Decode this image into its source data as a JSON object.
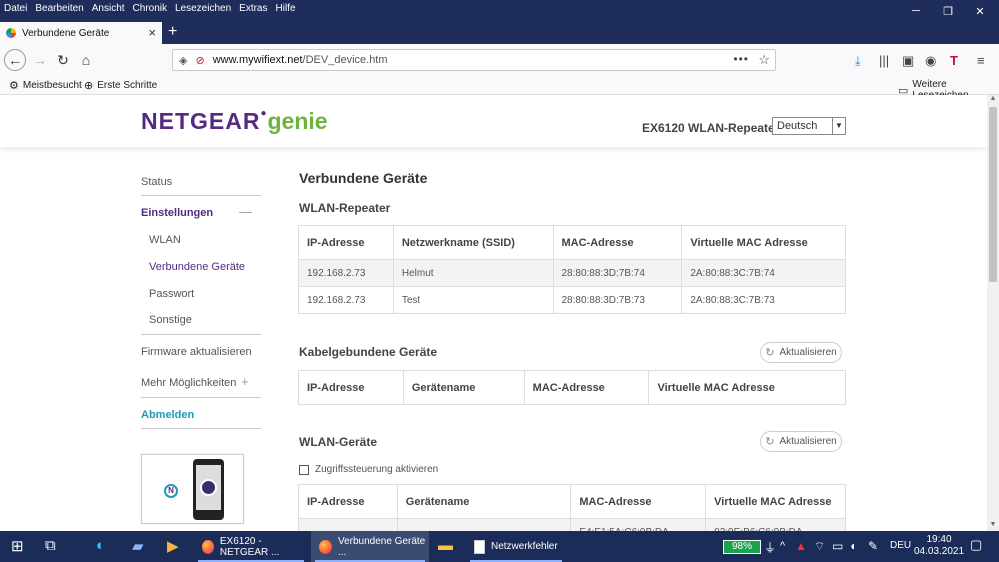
{
  "menubar": {
    "items": [
      "Datei",
      "Bearbeiten",
      "Ansicht",
      "Chronik",
      "Lesezeichen",
      "Extras",
      "Hilfe"
    ]
  },
  "window_controls": {
    "minimize": "─",
    "restore": "❐",
    "close": "✕"
  },
  "tab": {
    "title": "Verbundene Geräte",
    "close": "×",
    "new": "+"
  },
  "nav": {
    "url_domain": "www.mywifiext.net",
    "url_path": "/DEV_device.htm",
    "url_more": "•••",
    "star": "☆"
  },
  "bookmarks": {
    "items": [
      "Meistbesucht",
      "Erste Schritte"
    ],
    "other": "Weitere Lesezeichen"
  },
  "header": {
    "logo_brand": "NETGEAR",
    "logo_product": "genie",
    "model": "EX6120 WLAN-Repeater",
    "language": "Deutsch"
  },
  "sidebar": {
    "status": "Status",
    "settings": "Einstellungen",
    "settings_sign": "—",
    "sub_items": [
      "WLAN",
      "Verbundene Geräte",
      "Passwort",
      "Sonstige"
    ],
    "firmware": "Firmware aktualisieren",
    "more": "Mehr Möglichkeiten",
    "more_sign": "+",
    "logout": "Abmelden"
  },
  "main": {
    "title": "Verbundene Geräte",
    "wlan_repeater": {
      "heading": "WLAN-Repeater",
      "columns": [
        "IP-Adresse",
        "Netzwerkname (SSID)",
        "MAC-Adresse",
        "Virtuelle MAC Adresse"
      ],
      "rows": [
        [
          "192.168.2.73",
          "Helmut",
          "28:80:88:3D:7B:74",
          "2A:80:88:3C:7B:74"
        ],
        [
          "192.168.2.73",
          "Test",
          "28:80:88:3D:7B:73",
          "2A:80:88:3C:7B:73"
        ]
      ]
    },
    "wired": {
      "heading": "Kabelgebundene Geräte",
      "refresh": "Aktualisieren",
      "columns": [
        "IP-Adresse",
        "Gerätename",
        "MAC-Adresse",
        "Virtuelle MAC Adresse"
      ]
    },
    "wlan_devices": {
      "heading": "WLAN-Geräte",
      "refresh": "Aktualisieren",
      "access_control": "Zugriffssteuerung aktivieren",
      "columns": [
        "IP-Adresse",
        "Gerätename",
        "MAC-Adresse",
        "Virtuelle MAC Adresse"
      ],
      "partial_row": [
        "",
        "",
        "E4:E1:5A:C6:9B:DA",
        "02:9E:B6:C6:9B:DA"
      ]
    }
  },
  "taskbar": {
    "apps": [
      "EX6120 - NETGEAR ...",
      "Verbundene Geräte ...",
      "Netzwerkfehler"
    ],
    "battery": "98%",
    "language": "DEU",
    "time": "19:40",
    "date": "04.03.2021"
  },
  "colors": {
    "brand_purple": "#562a81",
    "genie_green": "#6fb33e",
    "link_teal": "#1d9ab8",
    "titlebar": "#1e2d5b",
    "taskbar": "#1a2c57"
  }
}
